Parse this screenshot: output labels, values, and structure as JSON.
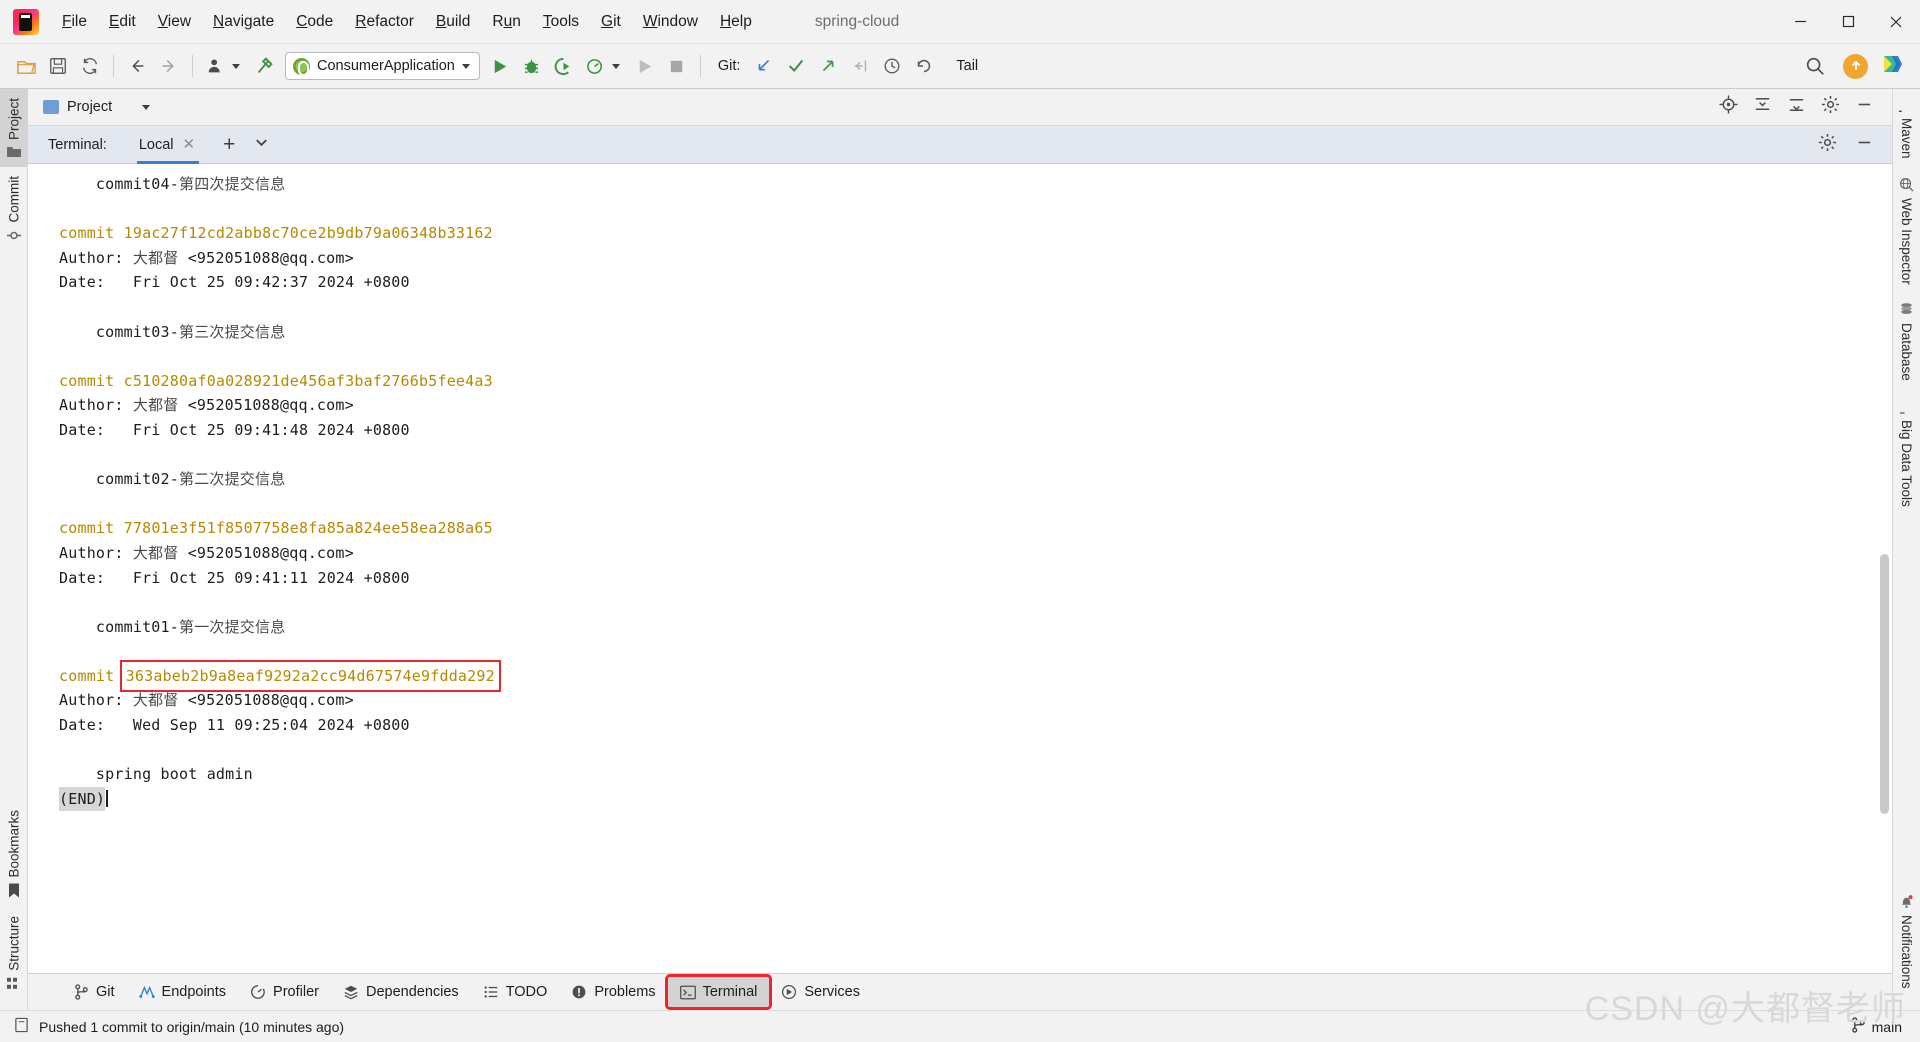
{
  "window": {
    "app_icon": "intellij-logo-icon",
    "project_name": "spring-cloud",
    "minimize_label": "Minimize",
    "maximize_label": "Maximize",
    "close_label": "Close"
  },
  "menubar": {
    "items": [
      {
        "label": "File",
        "mnemonic": "F"
      },
      {
        "label": "Edit",
        "mnemonic": "E"
      },
      {
        "label": "View",
        "mnemonic": "V"
      },
      {
        "label": "Navigate",
        "mnemonic": "N"
      },
      {
        "label": "Code",
        "mnemonic": "C"
      },
      {
        "label": "Refactor",
        "mnemonic": "R"
      },
      {
        "label": "Build",
        "mnemonic": "B"
      },
      {
        "label": "Run",
        "mnemonic": "u"
      },
      {
        "label": "Tools",
        "mnemonic": "T"
      },
      {
        "label": "Git",
        "mnemonic": "G"
      },
      {
        "label": "Window",
        "mnemonic": "W"
      },
      {
        "label": "Help",
        "mnemonic": "H"
      }
    ]
  },
  "toolbar": {
    "open_label": "Open",
    "save_label": "Save All",
    "sync_label": "Synchronize",
    "back_label": "Back",
    "forward_label": "Forward",
    "profile_label": "Profile",
    "build_label": "Build",
    "run_config": "ConsumerApplication",
    "run_label": "Run",
    "debug_label": "Debug",
    "run_coverage_label": "Run with Coverage",
    "profiler_label": "Profiler",
    "attach_label": "Attach",
    "stop_label": "Stop",
    "git_label": "Git:",
    "git_update_label": "Update Project",
    "git_commit_label": "Commit",
    "git_push_label": "Push",
    "git_rollback_label": "Rollback",
    "git_history_label": "History",
    "undo_label": "Undo",
    "tail_label": "Tail",
    "search_label": "Search Everywhere",
    "update_badge_label": "Update available",
    "ide_badge_label": "Toolbox"
  },
  "left_strip": {
    "items": [
      {
        "label": "Project",
        "icon": "folder-icon",
        "selected": true
      },
      {
        "label": "Commit",
        "icon": "commit-node-icon",
        "selected": false
      },
      {
        "label": "Bookmarks",
        "icon": "bookmark-icon",
        "selected": false
      },
      {
        "label": "Structure",
        "icon": "structure-icon",
        "selected": false
      }
    ]
  },
  "right_strip": {
    "items": [
      {
        "label": "Maven",
        "icon": "maven-icon"
      },
      {
        "label": "Web Inspector",
        "icon": "globe-icon"
      },
      {
        "label": "Database",
        "icon": "database-icon"
      },
      {
        "label": "Big Data Tools",
        "icon": "bigdata-icon"
      },
      {
        "label": "Notifications",
        "icon": "bell-icon"
      }
    ]
  },
  "project_bar": {
    "title": "Project",
    "icon": "project-icon",
    "select_opened_file_label": "Select Opened File",
    "collapse_all_label": "Collapse All",
    "expand_all_label": "Expand All",
    "settings_label": "Options",
    "hide_label": "Hide"
  },
  "terminal": {
    "title": "Terminal:",
    "tab_label": "Local",
    "close_tab_label": "Close Tab",
    "new_tab_label": "New Session",
    "more_label": "More",
    "settings_label": "Settings",
    "hide_label": "Hide",
    "author_name": "大都督",
    "author_email": "<952051088@qq.com>",
    "prompt_end": "(END)",
    "highlighted_hash": "363abeb2b9a8eaf9292a2cc94d67574e9fdda292",
    "lines": [
      {
        "type": "message",
        "text": "    commit04-第四次提交信息"
      },
      {
        "type": "blank",
        "text": ""
      },
      {
        "type": "commit",
        "label": "commit ",
        "hash": "19ac27f12cd2abb8c70ce2b9db79a06348b33162",
        "boxed": false
      },
      {
        "type": "author",
        "text": "Author: 大都督 <952051088@qq.com>"
      },
      {
        "type": "date",
        "text": "Date:   Fri Oct 25 09:42:37 2024 +0800"
      },
      {
        "type": "blank",
        "text": ""
      },
      {
        "type": "message",
        "text": "    commit03-第三次提交信息"
      },
      {
        "type": "blank",
        "text": ""
      },
      {
        "type": "commit",
        "label": "commit ",
        "hash": "c510280af0a028921de456af3baf2766b5fee4a3",
        "boxed": false
      },
      {
        "type": "author",
        "text": "Author: 大都督 <952051088@qq.com>"
      },
      {
        "type": "date",
        "text": "Date:   Fri Oct 25 09:41:48 2024 +0800"
      },
      {
        "type": "blank",
        "text": ""
      },
      {
        "type": "message",
        "text": "    commit02-第二次提交信息"
      },
      {
        "type": "blank",
        "text": ""
      },
      {
        "type": "commit",
        "label": "commit ",
        "hash": "77801e3f51f8507758e8fa85a824ee58ea288a65",
        "boxed": false
      },
      {
        "type": "author",
        "text": "Author: 大都督 <952051088@qq.com>"
      },
      {
        "type": "date",
        "text": "Date:   Fri Oct 25 09:41:11 2024 +0800"
      },
      {
        "type": "blank",
        "text": ""
      },
      {
        "type": "message",
        "text": "    commit01-第一次提交信息"
      },
      {
        "type": "blank",
        "text": ""
      },
      {
        "type": "commit",
        "label": "commit ",
        "hash": "363abeb2b9a8eaf9292a2cc94d67574e9fdda292",
        "boxed": true
      },
      {
        "type": "author",
        "text": "Author: 大都督 <952051088@qq.com>"
      },
      {
        "type": "date",
        "text": "Date:   Wed Sep 11 09:25:04 2024 +0800"
      },
      {
        "type": "blank",
        "text": ""
      },
      {
        "type": "message",
        "text": "    spring boot admin"
      },
      {
        "type": "end",
        "text": "(END)"
      }
    ]
  },
  "bottom_bar": {
    "items": [
      {
        "label": "Git",
        "icon": "git-branch-icon",
        "selected": false,
        "highlighted": false
      },
      {
        "label": "Endpoints",
        "icon": "endpoints-icon",
        "selected": false,
        "highlighted": false
      },
      {
        "label": "Profiler",
        "icon": "profiler-icon",
        "selected": false,
        "highlighted": false
      },
      {
        "label": "Dependencies",
        "icon": "dependencies-icon",
        "selected": false,
        "highlighted": false
      },
      {
        "label": "TODO",
        "icon": "todo-list-icon",
        "selected": false,
        "highlighted": false
      },
      {
        "label": "Problems",
        "icon": "problems-icon",
        "selected": false,
        "highlighted": false
      },
      {
        "label": "Terminal",
        "icon": "terminal-icon",
        "selected": true,
        "highlighted": true
      },
      {
        "label": "Services",
        "icon": "services-icon",
        "selected": false,
        "highlighted": false
      }
    ]
  },
  "status_bar": {
    "icon": "memory-icon",
    "message": "Pushed 1 commit to origin/main (10 minutes ago)",
    "branch_icon": "git-branch-icon",
    "branch": "main"
  },
  "watermark": {
    "text": "CSDN @大都督老师"
  },
  "colors": {
    "accent_blue": "#3a7dd9",
    "hash_gold": "#b58900",
    "highlight_red": "#e8262b",
    "terminal_bg": "#ffffff",
    "chrome_bg": "#f2f2f2",
    "terminal_head_bg": "#e3e7ef"
  }
}
